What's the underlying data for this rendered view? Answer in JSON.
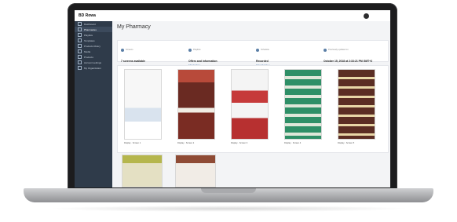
{
  "topbar": {
    "logo": "BD Rowa",
    "app_title": "",
    "username": ""
  },
  "sidebar": {
    "items": [
      {
        "label": "Dashboard",
        "active": false
      },
      {
        "label": "Pharmacies",
        "active": true
      },
      {
        "label": "Playlists",
        "active": false
      },
      {
        "label": "Templates",
        "active": false
      },
      {
        "label": "Products library",
        "active": false
      },
      {
        "label": "Media",
        "active": false
      },
      {
        "label": "Products",
        "active": false
      },
      {
        "label": "Account settings",
        "active": false
      },
      {
        "label": "My Organization",
        "active": false
      }
    ]
  },
  "main": {
    "title": "My Pharmacy",
    "subtitle": "",
    "stats": [
      {
        "label": "Screens",
        "value": "7 screens available",
        "link": ""
      },
      {
        "label": "Playlists",
        "value": "Offers and information",
        "link": "Edit playlist >"
      },
      {
        "label": "Schedule",
        "value": "Recorded",
        "link": "Edit schedule >"
      },
      {
        "label": "Previously updated on",
        "value": "October 15, 2018 at 2:33:21 PM GMT+2",
        "link": ""
      }
    ],
    "cards": [
      {
        "label": "Display · Screen 1",
        "accent": "#f7f7f7"
      },
      {
        "label": "Display · Screen 2",
        "accent": "#7a2c23"
      },
      {
        "label": "Display · Screen 3",
        "accent": "#f4f4f4"
      },
      {
        "label": "Display · Screen 4",
        "accent": "#2f8f67"
      },
      {
        "label": "Display · Screen 5",
        "accent": "#5b2e24"
      }
    ],
    "row2": [
      {
        "accent": "#b5b64d"
      },
      {
        "accent": "#8f4b35"
      }
    ]
  },
  "colors": {
    "sidebar": "#2f3b4a",
    "accent_link": "#4a78b0"
  }
}
